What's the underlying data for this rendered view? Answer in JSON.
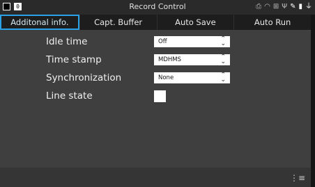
{
  "window": {
    "title": "Record Control"
  },
  "tabs": [
    {
      "label": "Additonal info."
    },
    {
      "label": "Capt. Buffer"
    },
    {
      "label": "Auto Save"
    },
    {
      "label": "Auto Run"
    }
  ],
  "active_tab": "Additonal info.",
  "settings": {
    "idle_time": {
      "label": "Idle time",
      "value": "Off"
    },
    "time_stamp": {
      "label": "Time stamp",
      "value": "MDHMS"
    },
    "synchronization": {
      "label": "Synchronization",
      "value": "None"
    },
    "line_state": {
      "label": "Line state",
      "checked": false
    }
  },
  "status_icons": {
    "indicator_number": "0",
    "icons": [
      "printer-icon",
      "wifi-icon",
      "network-icon",
      "usb-icon",
      "pen-icon",
      "battery-icon",
      "plug-icon"
    ]
  },
  "colors": {
    "accent": "#2aa1e6",
    "background": "#3f3f3f"
  }
}
